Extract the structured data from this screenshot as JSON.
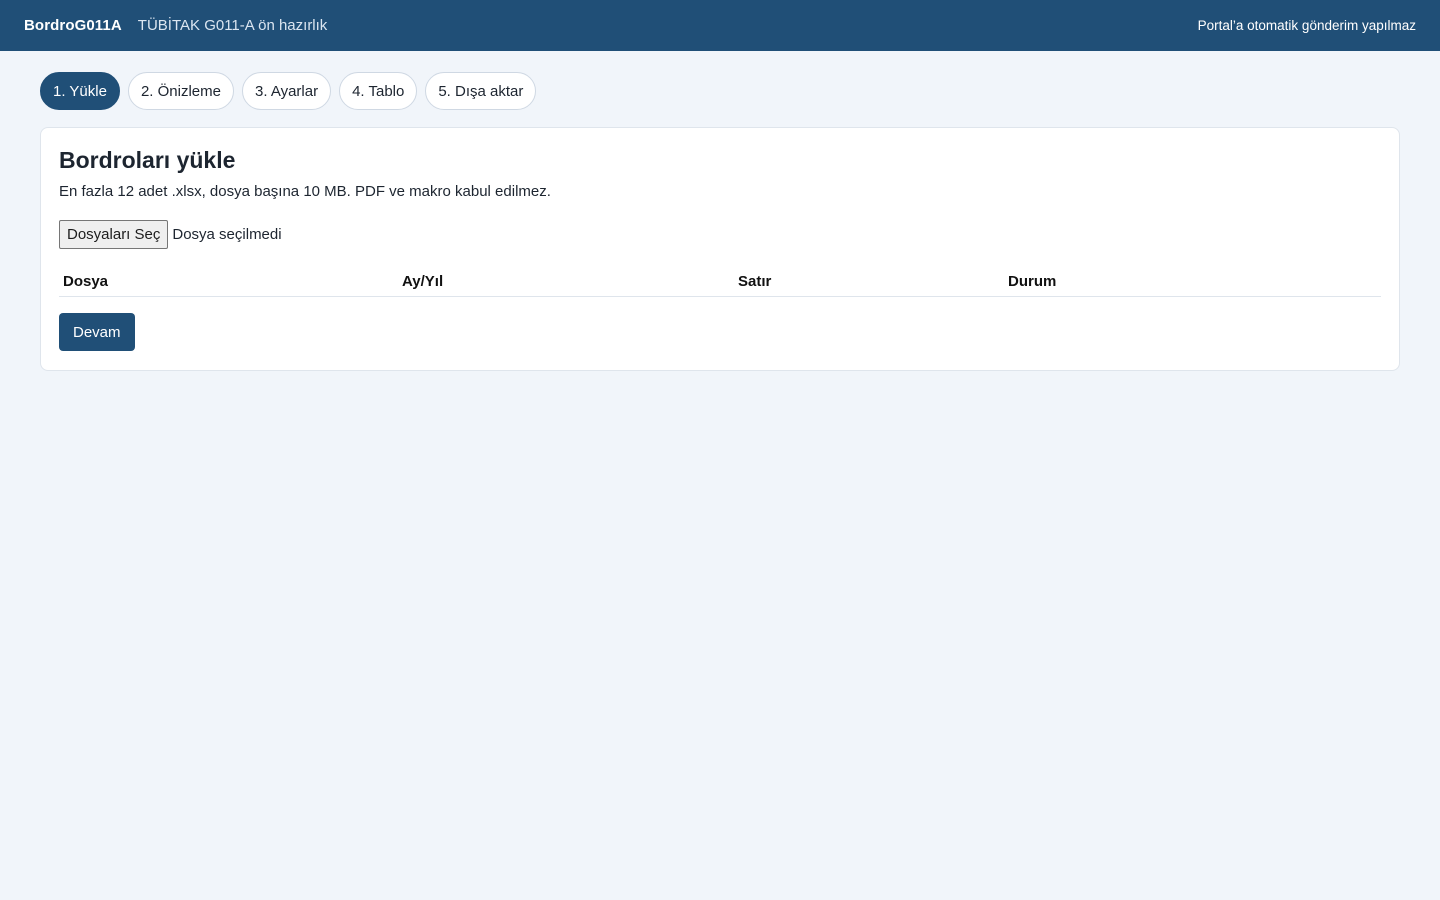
{
  "header": {
    "brand": "BordroG011A",
    "subtitle": "TÜBİTAK G011-A ön hazırlık",
    "notice": "Portal’a otomatik gönderim yapılmaz"
  },
  "steps": [
    {
      "label": "1. Yükle",
      "active": true
    },
    {
      "label": "2. Önizleme",
      "active": false
    },
    {
      "label": "3. Ayarlar",
      "active": false
    },
    {
      "label": "4. Tablo",
      "active": false
    },
    {
      "label": "5. Dışa aktar",
      "active": false
    }
  ],
  "upload": {
    "title": "Bordroları yükle",
    "description": "En fazla 12 adet .xlsx, dosya başına 10 MB. PDF ve makro kabul edilmez.",
    "choose_button": "Dosyaları Seç",
    "file_status": "Dosya seçilmedi",
    "table": {
      "headers": [
        "Dosya",
        "Ay/Yıl",
        "Satır",
        "Durum"
      ],
      "rows": []
    },
    "continue_button": "Devam"
  },
  "colors": {
    "primary": "#204f77",
    "background": "#f1f5fa",
    "card": "#ffffff"
  }
}
